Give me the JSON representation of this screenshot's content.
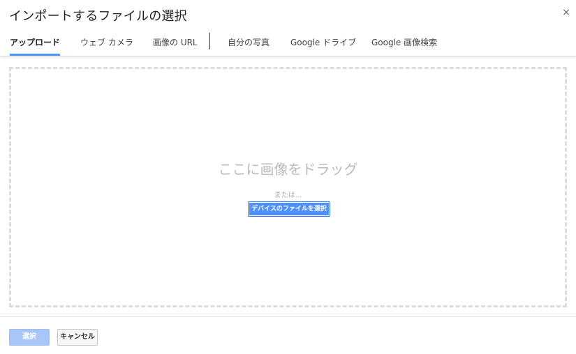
{
  "dialog": {
    "title": "インポートするファイルの選択",
    "close_glyph": "×"
  },
  "tabs": [
    {
      "label": "アップロード",
      "active": true
    },
    {
      "label": "ウェブ カメラ",
      "active": false
    },
    {
      "label": "画像の URL",
      "active": false
    },
    {
      "label": "自分の写真",
      "active": false
    },
    {
      "label": "Google ドライブ",
      "active": false
    },
    {
      "label": "Google 画像検索",
      "active": false
    }
  ],
  "dropzone": {
    "drag_text": "ここに画像をドラッグ",
    "or_text": "または...",
    "select_file_label": "デバイスのファイルを選択"
  },
  "footer": {
    "select_label": "選択",
    "cancel_label": "キャンセル"
  },
  "colors": {
    "accent": "#4d90fe",
    "disabled_button": "#a8c6f7",
    "dashed_border": "#dcdcdc"
  }
}
